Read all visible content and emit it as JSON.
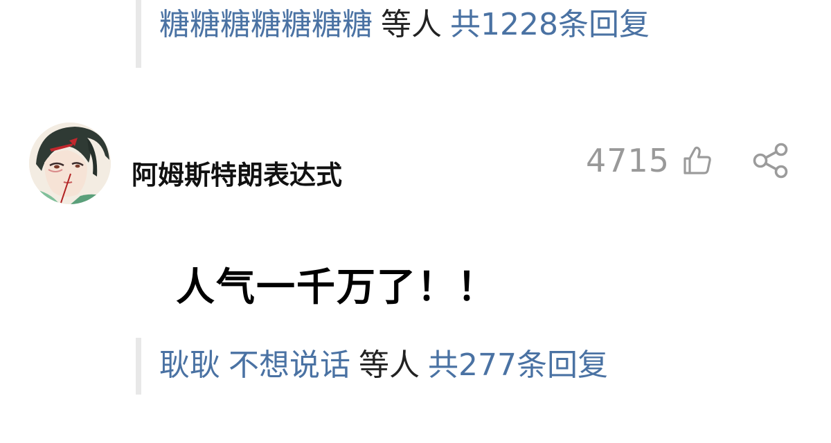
{
  "top_reply_preview": {
    "users": "糖糖糖糖糖糖糖",
    "suffix": "等人",
    "count_text": "共1228条回复"
  },
  "comment": {
    "username": "阿姆斯特朗表达式",
    "like_count": "4715",
    "text": "人气一千万了！！"
  },
  "bottom_reply_preview": {
    "user1": "耿耿",
    "user2": "不想说话",
    "suffix": "等人",
    "count_text": "共277条回复"
  },
  "colors": {
    "link": "#4a72a3",
    "muted": "#999999",
    "text": "#111111",
    "border": "#e8e8e8"
  },
  "icons": {
    "like": "thumbs-up-icon",
    "share": "share-icon"
  }
}
